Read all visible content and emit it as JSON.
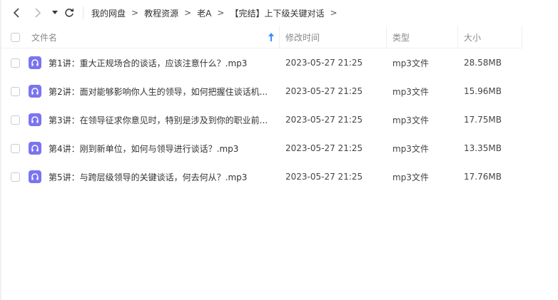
{
  "nav": {
    "back_icon": "chevron-left-icon",
    "forward_icon": "chevron-right-icon",
    "history_icon": "caret-down-icon",
    "refresh_icon": "refresh-icon"
  },
  "breadcrumb": [
    {
      "label": "我的网盘"
    },
    {
      "label": "教程资源"
    },
    {
      "label": "老A"
    },
    {
      "label": "【完结】上下级关键对话"
    }
  ],
  "breadcrumb_separator": ">",
  "columns": {
    "name": "文件名",
    "modified": "修改时间",
    "type": "类型",
    "size": "大小"
  },
  "sort": {
    "column": "name",
    "direction": "asc",
    "icon": "sort-up-arrow-icon",
    "color": "#3b8cff"
  },
  "files": [
    {
      "name": "第1讲：重大正规场合的谈话，应该注意什么？.mp3",
      "modified": "2023-05-27 21:25",
      "type": "mp3文件",
      "size": "28.58MB",
      "icon": "audio-file-icon"
    },
    {
      "name": "第2讲：面对能够影响你人生的领导，如何把握住谈话机...",
      "modified": "2023-05-27 21:25",
      "type": "mp3文件",
      "size": "15.96MB",
      "icon": "audio-file-icon"
    },
    {
      "name": "第3讲：在领导征求你意见时，特别是涉及到你的职业前...",
      "modified": "2023-05-27 21:25",
      "type": "mp3文件",
      "size": "17.75MB",
      "icon": "audio-file-icon"
    },
    {
      "name": "第4讲：刚到新单位，如何与领导进行谈话？.mp3",
      "modified": "2023-05-27 21:25",
      "type": "mp3文件",
      "size": "13.35MB",
      "icon": "audio-file-icon"
    },
    {
      "name": "第5讲：与跨层级领导的关键谈话，何去何从？.mp3",
      "modified": "2023-05-27 21:25",
      "type": "mp3文件",
      "size": "17.76MB",
      "icon": "audio-file-icon"
    }
  ],
  "colors": {
    "file_icon": "#7b74f0",
    "accent": "#3b8cff"
  }
}
